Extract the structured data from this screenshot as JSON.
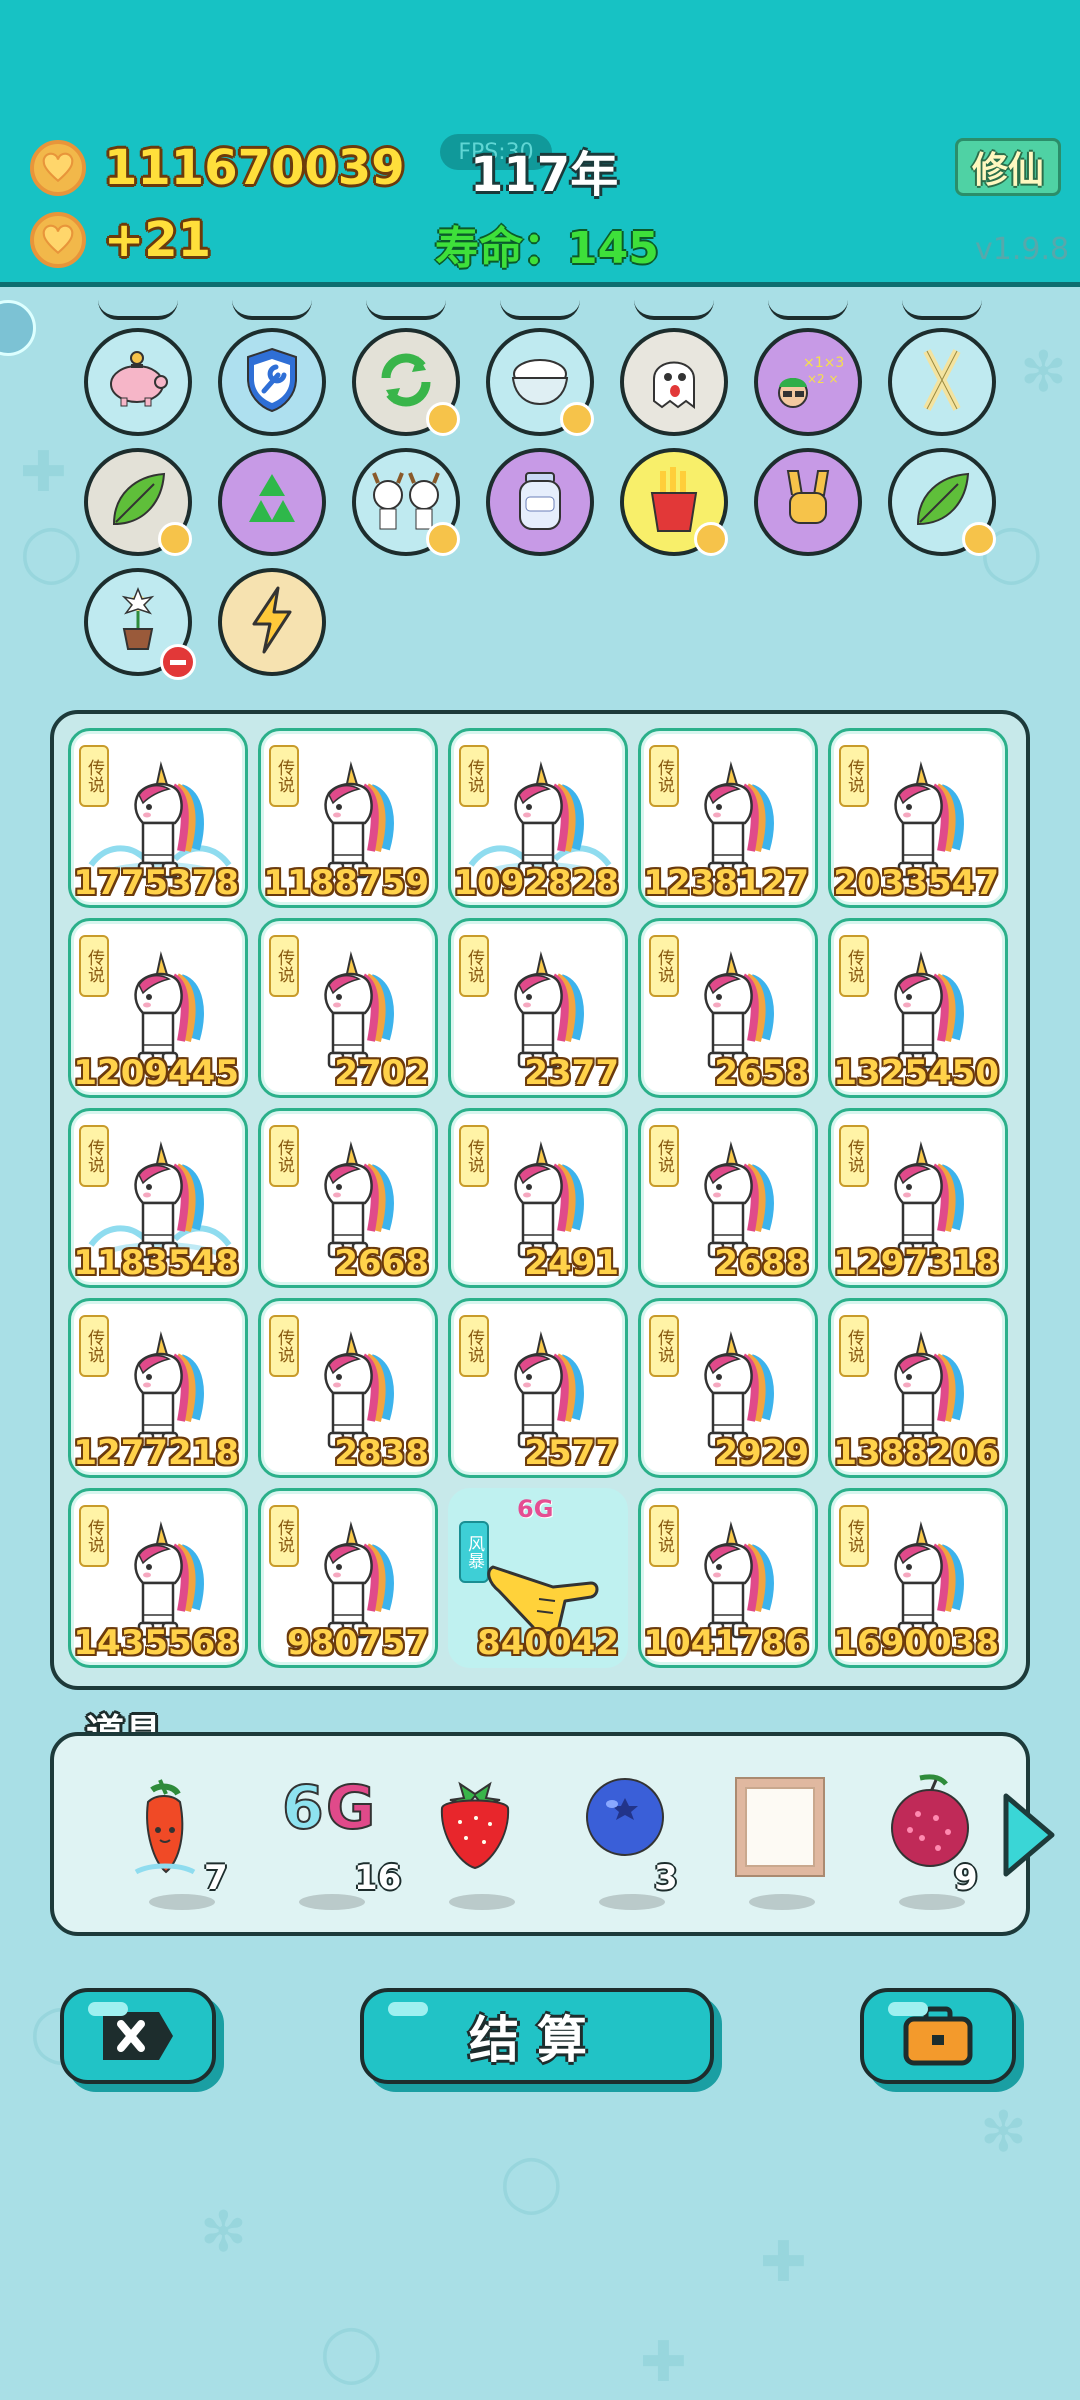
{
  "header": {
    "coins": "111670039",
    "coin_rate": "+21",
    "fps_label": "FPS:30",
    "year": "117年",
    "lifespan": "寿命：145",
    "cultivate_button": "修仙",
    "version": "v1.9.8"
  },
  "skills": [
    {
      "icon": "piggy-bank-icon",
      "bg": "#bfeaf0"
    },
    {
      "icon": "shield-wrench-icon",
      "bg": "#aee0ef"
    },
    {
      "icon": "refresh-icon",
      "bg": "#e3e1d7",
      "badge": true
    },
    {
      "icon": "rice-bowl-icon",
      "bg": "#bfeaf0",
      "badge": true
    },
    {
      "icon": "ghost-icon",
      "bg": "#e8e6de"
    },
    {
      "icon": "math-man-icon",
      "bg": "#c79ae6"
    },
    {
      "icon": "crossed-sticks-icon",
      "bg": "#bfeaf0"
    },
    {
      "icon": "leaf-icon",
      "bg": "#e3e1d7",
      "badge": true
    },
    {
      "icon": "recycle-icon",
      "bg": "#c79ae6"
    },
    {
      "icon": "twin-cows-icon",
      "bg": "#bfeaf0",
      "badge": true
    },
    {
      "icon": "milk-jar-icon",
      "bg": "#c79ae6"
    },
    {
      "icon": "fries-icon",
      "bg": "#f8ef6a",
      "badge": true
    },
    {
      "icon": "rock-hand-icon",
      "bg": "#c79ae6"
    },
    {
      "icon": "leaf-icon",
      "bg": "#bfeaf0",
      "badge": true
    },
    {
      "icon": "potted-flower-icon",
      "bg": "#bfeaf0",
      "minus": true
    },
    {
      "icon": "lightning-icon",
      "bg": "#f6e2b0"
    }
  ],
  "board": {
    "tag_label": "传说",
    "cells": [
      {
        "value": "1775378",
        "wave": true
      },
      {
        "value": "1188759"
      },
      {
        "value": "1092828",
        "wave": true
      },
      {
        "value": "1238127"
      },
      {
        "value": "2033547"
      },
      {
        "value": "1209445"
      },
      {
        "value": "2702"
      },
      {
        "value": "2377"
      },
      {
        "value": "2658"
      },
      {
        "value": "1325450"
      },
      {
        "value": "1183548",
        "wave": true
      },
      {
        "value": "2668"
      },
      {
        "value": "2491"
      },
      {
        "value": "2688"
      },
      {
        "value": "1297318"
      },
      {
        "value": "1277218"
      },
      {
        "value": "2838"
      },
      {
        "value": "2577"
      },
      {
        "value": "2929"
      },
      {
        "value": "1388206"
      },
      {
        "value": "1435568"
      },
      {
        "value": "980757"
      },
      {
        "value": "840042",
        "special": true
      },
      {
        "value": "1041786"
      },
      {
        "value": "1690038"
      }
    ],
    "special": {
      "tag": "风暴",
      "top_label": "6G"
    }
  },
  "props": {
    "title": "道具",
    "items": [
      {
        "icon": "chili-pepper-icon",
        "count": "7"
      },
      {
        "icon": "6g-icon",
        "label": "6G",
        "count": "16"
      },
      {
        "icon": "strawberry-icon",
        "count": ""
      },
      {
        "icon": "blueberry-icon",
        "count": "3"
      },
      {
        "icon": "frame-icon",
        "count": ""
      },
      {
        "icon": "lychee-icon",
        "count": "9"
      }
    ]
  },
  "buttons": {
    "exit_icon": "close-icon",
    "settle_label": "结算",
    "bag_icon": "briefcase-icon"
  },
  "colors": {
    "header_bg": "#17c2c4",
    "page_bg": "#a9dfe6",
    "accent": "#21c3c6",
    "coin_text": "#ffdf3b",
    "lifespan_text": "#3ee03a"
  }
}
